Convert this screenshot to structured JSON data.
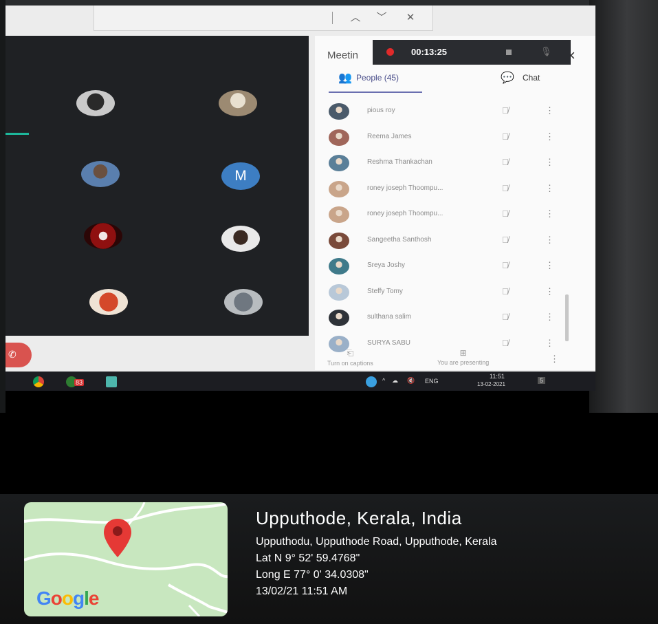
{
  "meeting": {
    "title": "Meetin",
    "close_label": "×",
    "recording_time": "00:13:25",
    "tabs": {
      "people_label": "People (45)",
      "chat_label": "Chat"
    },
    "tile_letter": "M",
    "participants": [
      {
        "name": "pious roy",
        "avatar_color": "#4a5a6a"
      },
      {
        "name": "Reema James",
        "avatar_color": "#a0665a"
      },
      {
        "name": "Reshma Thankachan",
        "avatar_color": "#5a7f98"
      },
      {
        "name": "roney joseph Thoompu...",
        "avatar_color": "#c9a58a"
      },
      {
        "name": "roney joseph Thoompu...",
        "avatar_color": "#c9a58a"
      },
      {
        "name": "Sangeetha Santhosh",
        "avatar_color": "#7a4a3a"
      },
      {
        "name": "Sreya Joshy",
        "avatar_color": "#3f7a8a"
      },
      {
        "name": "Steffy Tomy",
        "avatar_color": "#b8c8d8"
      },
      {
        "name": "sulthana salim",
        "avatar_color": "#2e3238"
      },
      {
        "name": "SURYA SABU",
        "avatar_color": "#9ab0c8"
      }
    ],
    "footer": {
      "captions_label": "Turn on captions",
      "presenting_label": "You are presenting"
    }
  },
  "taskbar": {
    "badge": "83",
    "lang": "ENG",
    "time": "11:51",
    "date": "13-02-2021",
    "notifications": "5"
  },
  "location": {
    "title": "Upputhode, Kerala, India",
    "address": "Upputhodu, Upputhode Road, Upputhode, Kerala",
    "lat": "Lat N 9° 52' 59.4768\"",
    "long": "Long E 77° 0' 34.0308\"",
    "timestamp": "13/02/21 11:51 AM",
    "map_brand": "Google"
  },
  "colors": {
    "accent": "#6a6fb0",
    "record": "#e02a2a",
    "map_green": "#c8e7bf",
    "pin": "#e53935"
  }
}
